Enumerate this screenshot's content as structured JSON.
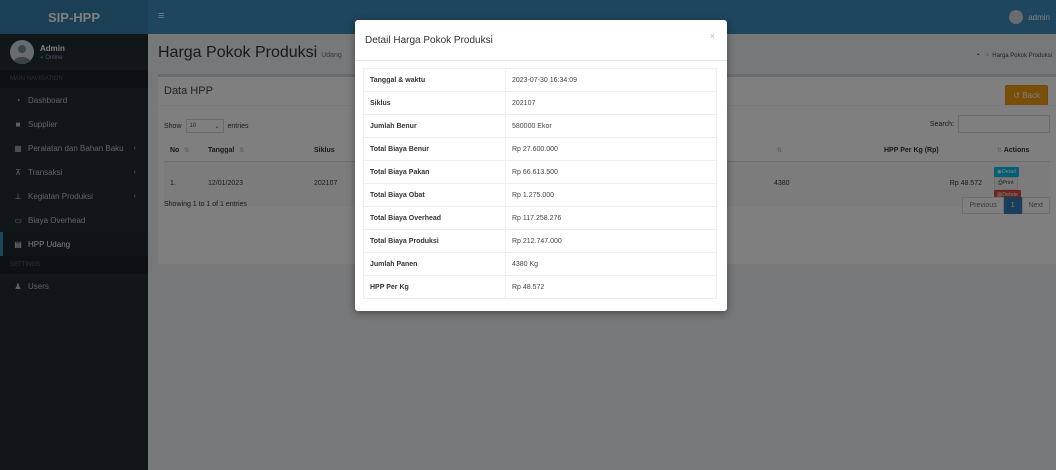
{
  "app": {
    "logo": "SIP-HPP"
  },
  "user": {
    "name": "Admin",
    "status": "Online",
    "top_name": "admin"
  },
  "sidebar": {
    "header_main": "MAIN NAVIGATION",
    "header_settings": "SETTINGS",
    "items": [
      {
        "label": "Dashboard",
        "icon": "dashboard-icon"
      },
      {
        "label": "Supplier",
        "icon": "truck-icon"
      },
      {
        "label": "Peralatan dan Bahan Baku",
        "icon": "inventory-icon"
      },
      {
        "label": "Transaksi",
        "icon": "cart-icon"
      },
      {
        "label": "Kegiatan Produksi",
        "icon": "sitemap-icon"
      },
      {
        "label": "Biaya Overhead",
        "icon": "money-icon"
      },
      {
        "label": "HPP Udang",
        "icon": "calculator-icon"
      }
    ],
    "users_label": "Users"
  },
  "header": {
    "title": "Harga Pokok Produksi",
    "subtitle": "Udang",
    "breadcrumb": "Harga Pokok Produksi"
  },
  "box": {
    "title": "Data HPP",
    "back_label": "Back",
    "show_label": "Show",
    "entries_value": "10",
    "entries_label": "entries",
    "search_label": "Search:",
    "showing": "Showing 1 to 1 of 1 entries",
    "previous": "Previous",
    "page": "1",
    "next": "Next"
  },
  "table": {
    "headers": {
      "no": "No",
      "tanggal": "Tanggal",
      "siklus": "Siklus",
      "hpp": "HPP Per Kg (Rp)",
      "actions": "Actions"
    },
    "row": {
      "no": "1.",
      "tanggal": "12/01/2023",
      "siklus": "202107",
      "panen": "4380",
      "hpp": "Rp 48.572"
    },
    "actions": {
      "detail": "Detail",
      "print": "Print",
      "delete": "Delete"
    }
  },
  "modal": {
    "title": "Detail Harga Pokok Produksi",
    "close": "×",
    "rows": [
      {
        "label": "Tanggal & waktu",
        "value": "2023-07-30 16:34:09"
      },
      {
        "label": "Siklus",
        "value": "202107"
      },
      {
        "label": "Jumlah Benur",
        "value": "580000 Ekor"
      },
      {
        "label": "Total Biaya Benur",
        "value": "Rp 27.600.000"
      },
      {
        "label": "Total Biaya Pakan",
        "value": "Rp 66.613.500"
      },
      {
        "label": "Total Biaya Obat",
        "value": "Rp 1.275.000"
      },
      {
        "label": "Total Biaya Overhead",
        "value": "Rp 117.258.276"
      },
      {
        "label": "Total Biaya Produksi",
        "value": "Rp 212.747.000"
      },
      {
        "label": "Jumlah Panen",
        "value": "4380 Kg"
      },
      {
        "label": "HPP Per Kg",
        "value": "Rp 48.572"
      }
    ]
  }
}
